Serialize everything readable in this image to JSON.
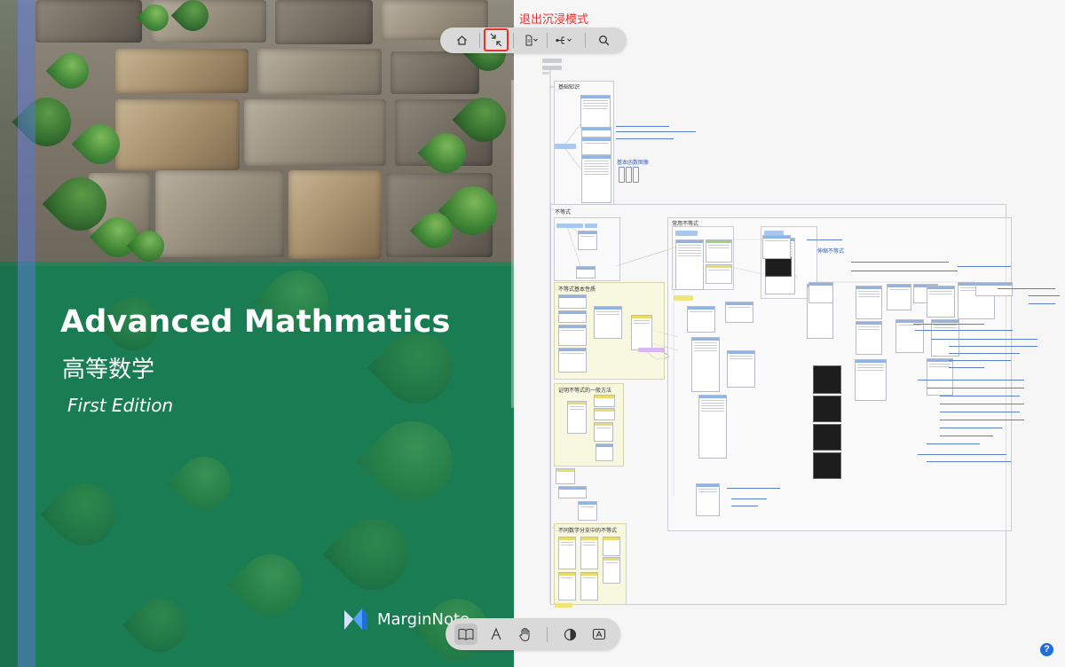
{
  "cover": {
    "title_en": "Advanced Mathmatics",
    "title_zh": "高等数学",
    "edition": "First Edition",
    "brand": "MarginNote",
    "overlay_color": "#14875a"
  },
  "immersive": {
    "exit_label": "退出沉浸模式",
    "exit_label_color": "#e5322d"
  },
  "toolbar_top": {
    "buttons": [
      {
        "name": "home",
        "icon": "home-icon"
      },
      {
        "name": "exit-immersive",
        "icon": "collapse-arrows-icon"
      },
      {
        "name": "document",
        "icon": "document-icon"
      },
      {
        "name": "mindmap",
        "icon": "mindmap-icon"
      },
      {
        "name": "search",
        "icon": "search-icon"
      }
    ]
  },
  "toolbar_bottom": {
    "buttons": [
      {
        "name": "book",
        "icon": "book-icon",
        "active": true
      },
      {
        "name": "pen",
        "icon": "pen-icon"
      },
      {
        "name": "hand",
        "icon": "hand-icon"
      },
      {
        "name": "contrast",
        "icon": "contrast-icon"
      },
      {
        "name": "text",
        "icon": "text-box-icon"
      }
    ]
  },
  "mindmap": {
    "sections": {
      "s1": "基础知识",
      "s2": "不等式",
      "s3": "常用不等式",
      "s4": "不等式基本性质",
      "s5": "证明不等式的一般方法",
      "s6": "不同数学分支中的不等式"
    },
    "handwriting": {
      "h1": "基本函数图像",
      "h2": "伸缩不等式"
    }
  },
  "help": "?"
}
